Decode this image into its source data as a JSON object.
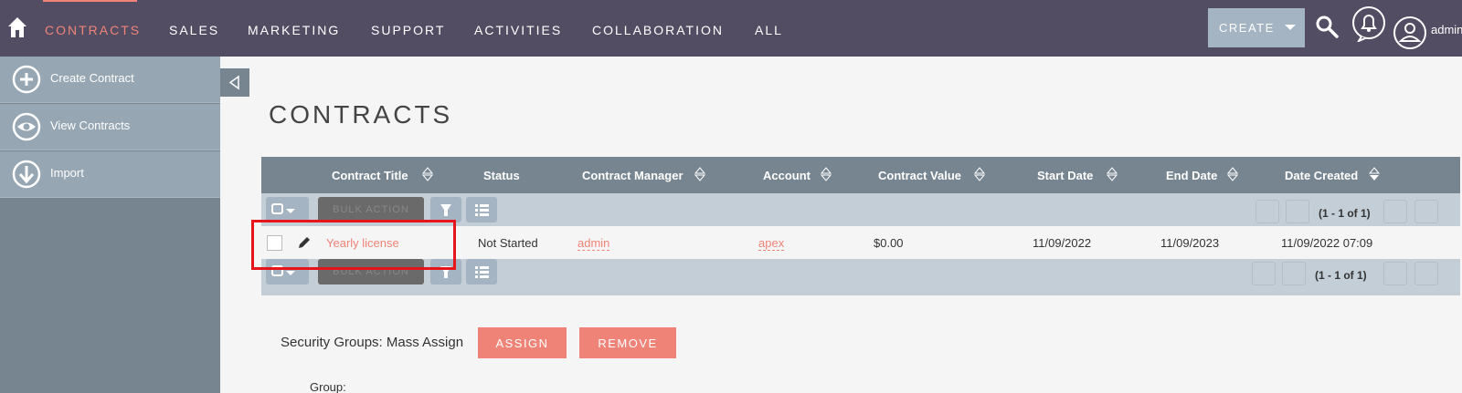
{
  "nav": {
    "items": [
      "CONTRACTS",
      "SALES",
      "MARKETING",
      "SUPPORT",
      "ACTIVITIES",
      "COLLABORATION",
      "ALL"
    ],
    "active": "CONTRACTS",
    "create_label": "CREATE",
    "username": "admin"
  },
  "sidebar": {
    "items": [
      {
        "label": "Create Contract",
        "icon": "plus-circle-icon"
      },
      {
        "label": "View Contracts",
        "icon": "eye-icon"
      },
      {
        "label": "Import",
        "icon": "download-icon"
      }
    ]
  },
  "page": {
    "title": "CONTRACTS"
  },
  "table": {
    "columns": [
      "Contract Title",
      "Status",
      "Contract Manager",
      "Account",
      "Contract Value",
      "Start Date",
      "End Date",
      "Date Created"
    ],
    "bulk_action_label": "BULK ACTION",
    "pagination": "(1 - 1 of 1)",
    "rows": [
      {
        "title": "Yearly license",
        "status": "Not Started",
        "manager": "admin",
        "account": "apex",
        "value": "$0.00",
        "start": "11/09/2022",
        "end": "11/09/2023",
        "created": "11/09/2022 07:09"
      }
    ]
  },
  "security": {
    "label": "Security Groups: Mass Assign",
    "assign_label": "ASSIGN",
    "remove_label": "REMOVE",
    "group_label": "Group:"
  },
  "colors": {
    "nav_bg": "#534d64",
    "accent": "#f08377",
    "sidebar_bg": "#778591",
    "highlight": "#e8141c"
  }
}
